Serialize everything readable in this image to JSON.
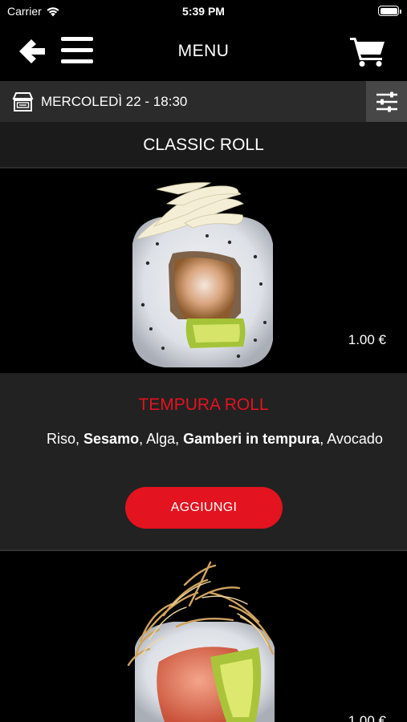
{
  "status_bar": {
    "carrier": "Carrier",
    "time": "5:39 PM"
  },
  "header": {
    "title": "MENU"
  },
  "delivery": {
    "datetime": "MERCOLEDÌ 22 - 18:30"
  },
  "category": {
    "title": "CLASSIC ROLL"
  },
  "products": [
    {
      "price": "1.00 €",
      "name": "TEMPURA ROLL",
      "ingredients": [
        {
          "text": "Riso",
          "bold": false
        },
        {
          "text": "Sesamo",
          "bold": true
        },
        {
          "text": "Alga",
          "bold": false
        },
        {
          "text": "Gamberi in tempura",
          "bold": true
        },
        {
          "text": "Avocado",
          "bold": false
        }
      ],
      "add_label": "AGGIUNGI"
    },
    {
      "price": "1.00 €"
    }
  ],
  "colors": {
    "accent": "#e3131f",
    "date_bar": "#2b2b2b",
    "filter_button": "#474747",
    "info_panel": "#222222"
  }
}
